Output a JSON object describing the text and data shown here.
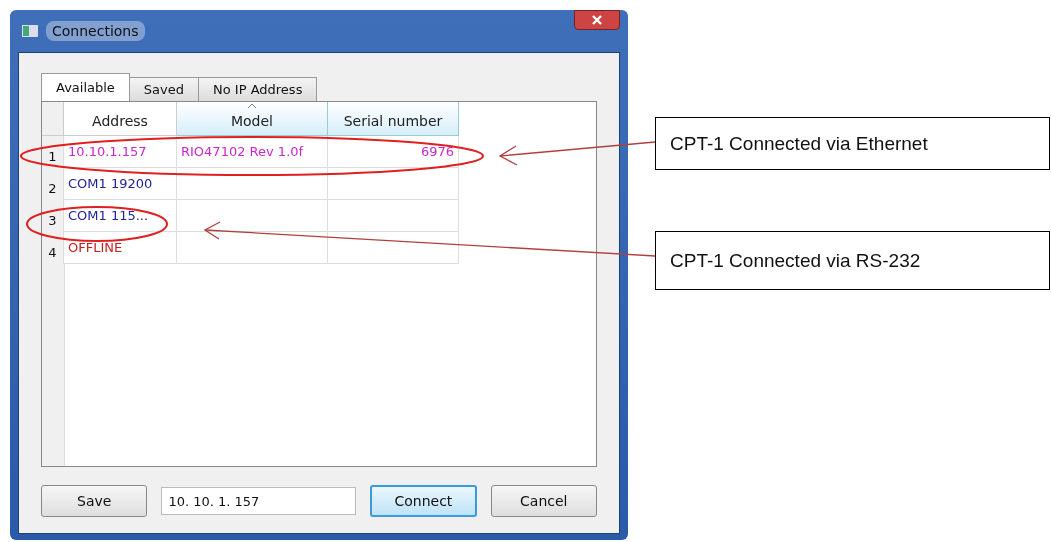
{
  "window": {
    "title": "Connections"
  },
  "tabs": [
    {
      "label": "Available",
      "selected": true
    },
    {
      "label": "Saved",
      "selected": false
    },
    {
      "label": "No IP Address",
      "selected": false
    }
  ],
  "table": {
    "columns": [
      {
        "label": "Address",
        "highlighted": false,
        "sorted": false
      },
      {
        "label": "Model",
        "highlighted": true,
        "sorted": true
      },
      {
        "label": "Serial number",
        "highlighted": true,
        "sorted": false
      }
    ],
    "rows": [
      {
        "number": "1",
        "color": "#c828c8",
        "cells": [
          "10.10.1.157",
          "RIO47102 Rev 1.0f",
          "6976"
        ]
      },
      {
        "number": "2",
        "color": "#22229a",
        "cells": [
          "COM1 19200",
          "",
          ""
        ]
      },
      {
        "number": "3",
        "color": "#22229a",
        "cells": [
          "COM1 115...",
          "",
          ""
        ]
      },
      {
        "number": "4",
        "color": "#c82020",
        "cells": [
          "OFFLINE",
          "",
          ""
        ]
      }
    ]
  },
  "address_field": {
    "value": "10. 10. 1. 157"
  },
  "buttons": [
    {
      "label": "Save",
      "default": false
    },
    {
      "label": "Connect",
      "default": true
    },
    {
      "label": "Cancel",
      "default": false
    }
  ],
  "callouts": [
    {
      "text": "CPT-1 Connected via Ethernet"
    },
    {
      "text": "CPT-1 Connected via RS-232"
    }
  ]
}
